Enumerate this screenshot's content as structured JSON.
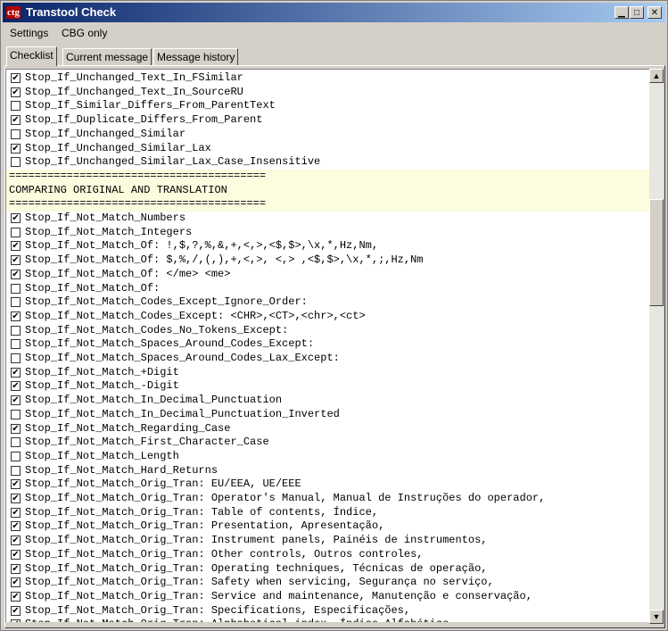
{
  "window": {
    "title": "Transtool Check",
    "icon_label": "ctg"
  },
  "menu": [
    "Settings",
    "CBG only"
  ],
  "tabs": [
    "Checklist",
    "Current message",
    "Message history"
  ],
  "active_tab": 0,
  "rows": [
    {
      "checked": true,
      "text": "Stop_If_Unchanged_Text_In_FSimilar"
    },
    {
      "checked": true,
      "text": "Stop_If_Unchanged_Text_In_SourceRU"
    },
    {
      "checked": false,
      "text": "Stop_If_Similar_Differs_From_ParentText"
    },
    {
      "checked": true,
      "text": "Stop_If_Duplicate_Differs_From_Parent"
    },
    {
      "checked": false,
      "text": "Stop_If_Unchanged_Similar"
    },
    {
      "checked": true,
      "text": "Stop_If_Unchanged_Similar_Lax"
    },
    {
      "checked": false,
      "text": "Stop_If_Unchanged_Similar_Lax_Case_Insensitive"
    },
    {
      "section": true,
      "text": "========================================"
    },
    {
      "section": true,
      "text": "COMPARING ORIGINAL AND TRANSLATION"
    },
    {
      "section": true,
      "text": "========================================"
    },
    {
      "checked": true,
      "text": "Stop_If_Not_Match_Numbers"
    },
    {
      "checked": false,
      "text": "Stop_If_Not_Match_Integers"
    },
    {
      "checked": true,
      "text": "Stop_If_Not_Match_Of: !,$,?,%,&,+,<,>,<$,$>,\\x,*,Hz,Nm,"
    },
    {
      "checked": true,
      "text": "Stop_If_Not_Match_Of: $,%,/,(,),+,<,>, <,> ,<$,$>,\\x,*,;,Hz,Nm"
    },
    {
      "checked": true,
      "text": "Stop_If_Not_Match_Of: </me> <me>"
    },
    {
      "checked": false,
      "text": "Stop_If_Not_Match_Of:"
    },
    {
      "checked": false,
      "text": "Stop_If_Not_Match_Codes_Except_Ignore_Order:"
    },
    {
      "checked": true,
      "text": "Stop_If_Not_Match_Codes_Except: <CHR>,<CT>,<chr>,<ct>"
    },
    {
      "checked": false,
      "text": "Stop_If_Not_Match_Codes_No_Tokens_Except:"
    },
    {
      "checked": false,
      "text": "Stop_If_Not_Match_Spaces_Around_Codes_Except:"
    },
    {
      "checked": false,
      "text": "Stop_If_Not_Match_Spaces_Around_Codes_Lax_Except:"
    },
    {
      "checked": true,
      "text": "Stop_If_Not_Match_+Digit"
    },
    {
      "checked": true,
      "text": "Stop_If_Not_Match_-Digit"
    },
    {
      "checked": true,
      "text": "Stop_If_Not_Match_In_Decimal_Punctuation"
    },
    {
      "checked": false,
      "text": "Stop_If_Not_Match_In_Decimal_Punctuation_Inverted"
    },
    {
      "checked": true,
      "text": "Stop_If_Not_Match_Regarding_Case"
    },
    {
      "checked": false,
      "text": "Stop_If_Not_Match_First_Character_Case"
    },
    {
      "checked": false,
      "text": "Stop_If_Not_Match_Length"
    },
    {
      "checked": false,
      "text": "Stop_If_Not_Match_Hard_Returns"
    },
    {
      "checked": true,
      "text": "Stop_If_Not_Match_Orig_Tran: EU/EEA, UE/EEE"
    },
    {
      "checked": true,
      "text": "Stop_If_Not_Match_Orig_Tran: Operator's Manual, Manual de Instruções do operador,"
    },
    {
      "checked": true,
      "text": "Stop_If_Not_Match_Orig_Tran: Table of contents, Índice,"
    },
    {
      "checked": true,
      "text": "Stop_If_Not_Match_Orig_Tran: Presentation, Apresentação,"
    },
    {
      "checked": true,
      "text": "Stop_If_Not_Match_Orig_Tran: Instrument panels, Painéis de instrumentos,"
    },
    {
      "checked": true,
      "text": "Stop_If_Not_Match_Orig_Tran: Other controls, Outros controles,"
    },
    {
      "checked": true,
      "text": "Stop_If_Not_Match_Orig_Tran: Operating techniques, Técnicas de operação,"
    },
    {
      "checked": true,
      "text": "Stop_If_Not_Match_Orig_Tran: Safety when servicing, Segurança no serviço,"
    },
    {
      "checked": true,
      "text": "Stop_If_Not_Match_Orig_Tran: Service and maintenance, Manutenção e conservação,"
    },
    {
      "checked": true,
      "text": "Stop_If_Not_Match_Orig_Tran: Specifications, Especificações,"
    },
    {
      "checked": true,
      "text": "Stop_If_Not_Match_Orig_Tran: Alphabetical index, Índice Alfabético,"
    }
  ],
  "colors": {
    "title_start": "#0a246a",
    "title_end": "#a6caf0",
    "section_bg": "#fcfcdf",
    "window_bg": "#d4d0c8"
  }
}
